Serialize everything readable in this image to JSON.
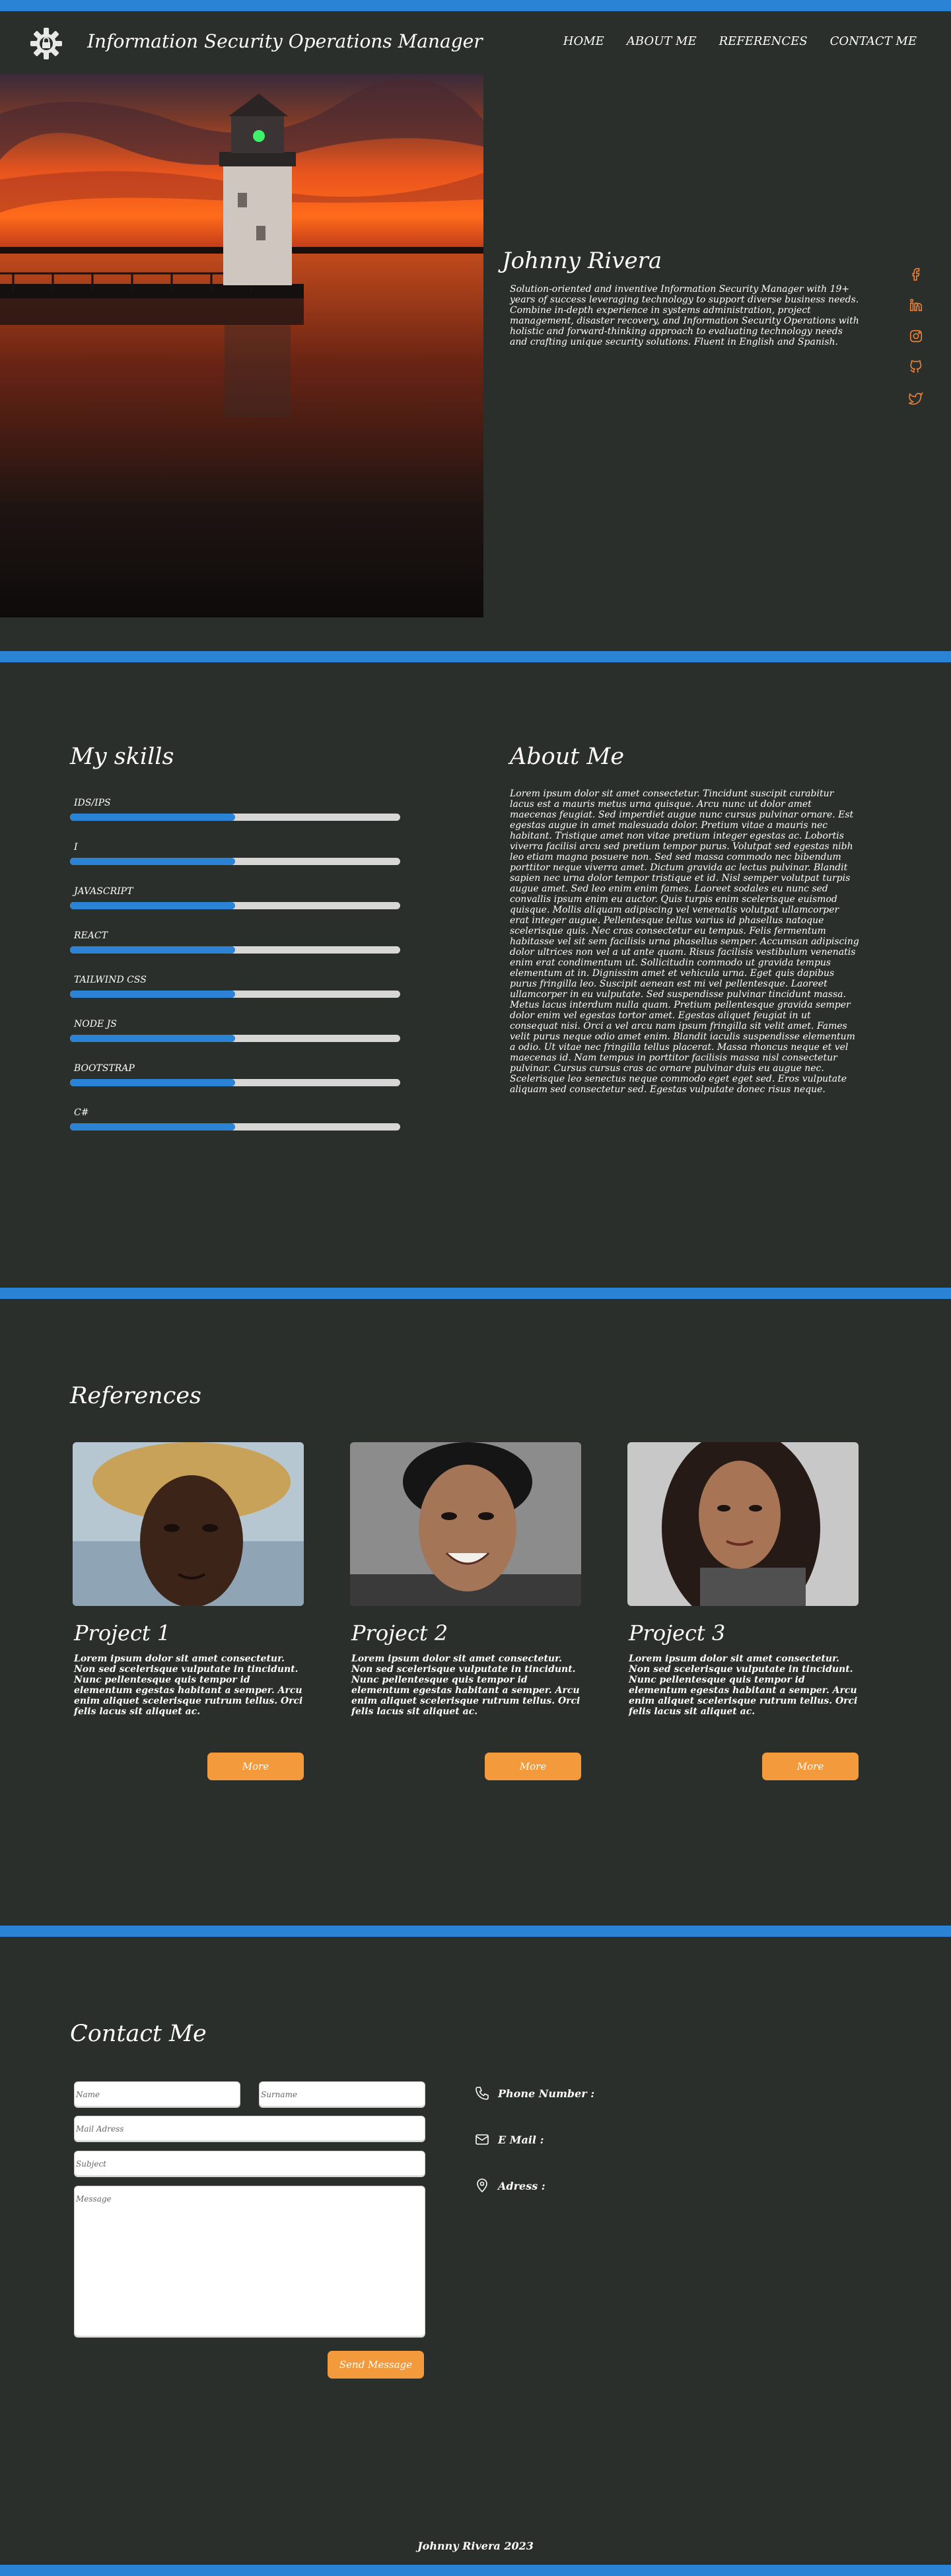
{
  "nav": {
    "title": "Information Security Operations Manager",
    "links": [
      "HOME",
      "ABOUT ME",
      "REFERENCES",
      "CONTACT ME"
    ]
  },
  "hero": {
    "name": "Johnny Rivera",
    "bio": "Solution-oriented and inventive Information Security Manager with 19+ years of success leveraging technology to support diverse business needs. Combine in-depth experience in systems administration, project management, disaster recovery, and Information Security Operations with holistic and forward-thinking approach to evaluating technology needs and crafting unique security solutions. Fluent in English and Spanish.",
    "socials": [
      "facebook-icon",
      "linkedin-icon",
      "instagram-icon",
      "github-icon",
      "twitter-icon"
    ]
  },
  "skills": {
    "heading": "My skills",
    "items": [
      {
        "label": "IDS/IPS",
        "level": 0.5
      },
      {
        "label": "I",
        "level": 0.5
      },
      {
        "label": "JAVASCRIPT",
        "level": 0.5
      },
      {
        "label": "REACT",
        "level": 0.5
      },
      {
        "label": "TAILWIND CSS",
        "level": 0.5
      },
      {
        "label": "NODE JS",
        "level": 0.5
      },
      {
        "label": "BOOTSTRAP",
        "level": 0.5
      },
      {
        "label": "C#",
        "level": 0.5
      }
    ]
  },
  "about": {
    "heading": "About Me",
    "text": "Lorem ipsum dolor sit amet consectetur. Tincidunt suscipit curabitur lacus est a mauris metus urna quisque. Arcu nunc ut dolor amet maecenas feugiat. Sed imperdiet augue nunc cursus pulvinar ornare. Est egestas augue in amet malesuada dolor. Pretium vitae a mauris nec habitant. Tristique amet non vitae pretium integer egestas ac. Lobortis viverra facilisi arcu sed pretium tempor purus. Volutpat sed egestas nibh leo etiam magna posuere non. Sed sed massa commodo nec bibendum porttitor neque viverra amet. Dictum gravida ac lectus pulvinar. Blandit sapien nec urna dolor tempor tristique et id. Nisl semper volutpat turpis augue amet. Sed leo enim enim fames. Laoreet sodales eu nunc sed convallis ipsum enim eu auctor. Quis turpis enim scelerisque euismod quisque. Mollis aliquam adipiscing vel venenatis volutpat ullamcorper erat integer augue. Pellentesque tellus varius id phasellus natoque scelerisque quis. Nec cras consectetur eu tempus. Felis fermentum habitasse vel sit sem facilisis urna phasellus semper. Accumsan adipiscing dolor ultrices non vel a ut ante quam. Risus facilisis vestibulum venenatis enim erat condimentum ut. Sollicitudin commodo ut gravida tempus elementum at in. Dignissim amet et vehicula urna. Eget quis dapibus purus fringilla leo. Suscipit aenean est mi vel pellentesque. Laoreet ullamcorper in eu vulputate. Sed suspendisse pulvinar tincidunt massa. Metus lacus interdum nulla quam. Pretium pellentesque gravida semper dolor enim vel egestas tortor amet. Egestas aliquet feugiat in ut consequat nisi. Orci a vel arcu nam ipsum fringilla sit velit amet. Fames velit purus neque odio amet enim. Blandit iaculis suspendisse elementum a odio. Ut vitae nec fringilla tellus placerat. Massa rhoncus neque et vel maecenas id. Nam tempus in porttitor facilisis massa nisl consectetur pulvinar. Cursus cursus cras ac ornare pulvinar duis eu augue nec. Scelerisque leo senectus neque commodo eget eget sed. Eros vulputate aliquam sed consectetur sed. Egestas vulputate donec risus neque."
  },
  "references": {
    "heading": "References",
    "cards": [
      {
        "title": "Project 1",
        "text": "Lorem ipsum dolor sit amet consectetur. Non sed scelerisque vulputate in tincidunt. Nunc pellentesque quis tempor id elementum egestas habitant a semper. Arcu enim aliquet scelerisque rutrum tellus. Orci felis lacus sit aliquet ac.",
        "button": "More",
        "photo": "man-straw-hat"
      },
      {
        "title": "Project 2",
        "text": "Lorem ipsum dolor sit amet consectetur. Non sed scelerisque vulputate in tincidunt. Nunc pellentesque quis tempor id elementum egestas habitant a semper. Arcu enim aliquet scelerisque rutrum tellus. Orci felis lacus sit aliquet ac.",
        "button": "More",
        "photo": "smiling-person"
      },
      {
        "title": "Project 3",
        "text": "Lorem ipsum dolor sit amet consectetur. Non sed scelerisque vulputate in tincidunt. Nunc pellentesque quis tempor id elementum egestas habitant a semper. Arcu enim aliquet scelerisque rutrum tellus. Orci felis lacus sit aliquet ac.",
        "button": "More",
        "photo": "woman-long-hair"
      }
    ]
  },
  "contact": {
    "heading": "Contact Me",
    "placeholders": {
      "name": "Name",
      "surname": "Surname",
      "mail": "Mail Adress",
      "subject": "Subject",
      "message": "Message"
    },
    "send_label": "Send Message",
    "info": {
      "phone": "Phone Number :",
      "email": "E Mail :",
      "address": "Adress :"
    }
  },
  "footer": {
    "text": "Johnny Rivera 2023"
  },
  "colors": {
    "background": "#2b2f2b",
    "accent_blue": "#2b83d6",
    "button_orange": "#f39a3d",
    "social_orange": "#e9803a"
  }
}
